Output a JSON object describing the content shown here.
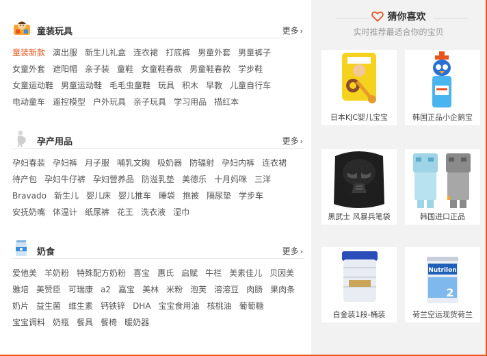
{
  "sections": [
    {
      "title": "童装玩具",
      "icon": "kid-icon",
      "more_label": "更多",
      "tags": [
        "童装新款",
        "演出服",
        "新生儿礼盒",
        "连衣裙",
        "打底裤",
        "男童外套",
        "男童裤子",
        "女童外套",
        "遮阳帽",
        "亲子装",
        "童鞋",
        "女童鞋春款",
        "男童鞋春款",
        "学步鞋",
        "女童运动鞋",
        "男童运动鞋",
        "毛毛虫童鞋",
        "玩具",
        "积木",
        "早教",
        "儿童自行车",
        "电动童车",
        "遥控模型",
        "户外玩具",
        "亲子玩具",
        "学习用品",
        "描红本"
      ],
      "active_tag": "童装新款"
    },
    {
      "title": "孕产用品",
      "icon": "maternity-icon",
      "more_label": "更多",
      "tags": [
        "孕妇春装",
        "孕妇裤",
        "月子服",
        "哺乳文胸",
        "吸奶器",
        "防辐射",
        "孕妇内裤",
        "连衣裙",
        "待产包",
        "孕妇牛仔裤",
        "孕妇营养品",
        "防溢乳垫",
        "美德乐",
        "十月妈咪",
        "三洋",
        "Bravado",
        "新生儿",
        "婴儿床",
        "婴儿推车",
        "睡袋",
        "抱被",
        "隔尿垫",
        "学步车",
        "安抚奶嘴",
        "体温计",
        "纸尿裤",
        "花王",
        "洗衣液",
        "湿巾"
      ]
    },
    {
      "title": "奶食",
      "icon": "milk-can-icon",
      "more_label": "更多",
      "tags": [
        "爱他美",
        "羊奶粉",
        "特殊配方奶粉",
        "喜宝",
        "惠氏",
        "启赋",
        "牛栏",
        "美素佳儿",
        "贝因美",
        "雅培",
        "美赞臣",
        "可瑞康",
        "a2",
        "嘉宝",
        "美林",
        "米粉",
        "泡芙",
        "溶溶豆",
        "肉肠",
        "果肉条",
        "奶片",
        "益生菌",
        "维生素",
        "钙铁锌",
        "DHA",
        "宝宝食用油",
        "核桃油",
        "葡萄糖",
        "宝宝调料",
        "奶瓶",
        "餐具",
        "餐椅",
        "暖奶器"
      ]
    }
  ],
  "recommend": {
    "title": "猜你喜欢",
    "subtitle": "实时推荐最适合你的宝贝",
    "icon": "heart-icon",
    "items": [
      {
        "caption": "日本KJC婴儿宝宝",
        "image": "teether-image"
      },
      {
        "caption": "韩国正品小企鹅宝",
        "image": "penguin-bottle-image"
      },
      {
        "caption": "黑武士 风暴兵笔袋",
        "image": "darth-vader-pencil-case-image"
      },
      {
        "caption": "韩国进口正品",
        "image": "robot-bottles-image"
      },
      {
        "caption": "白金装1段-桶装",
        "image": "formula-can-image"
      },
      {
        "caption": "荷兰空运现货荷兰",
        "image": "nutrilon-can-image"
      }
    ]
  },
  "colors": {
    "accent": "#e8541e",
    "right_bg": "#f2f2f2",
    "divider": "#e6e6e6"
  }
}
